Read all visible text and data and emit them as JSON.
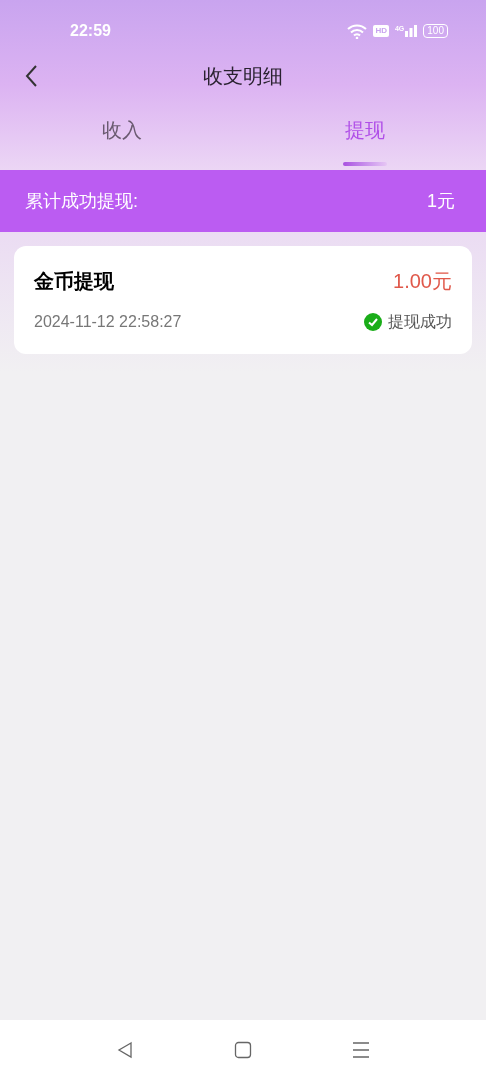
{
  "status_bar": {
    "time": "22:59",
    "hd": "HD",
    "network": "4G",
    "battery": "100"
  },
  "header": {
    "title": "收支明细"
  },
  "tabs": [
    {
      "label": "收入",
      "selected": false
    },
    {
      "label": "提现",
      "selected": true
    }
  ],
  "summary": {
    "label": "累计成功提现:",
    "value": "1元"
  },
  "records": [
    {
      "title": "金币提现",
      "amount": "1.00元",
      "time": "2024-11-12 22:58:27",
      "status": "提现成功",
      "success": true
    }
  ]
}
